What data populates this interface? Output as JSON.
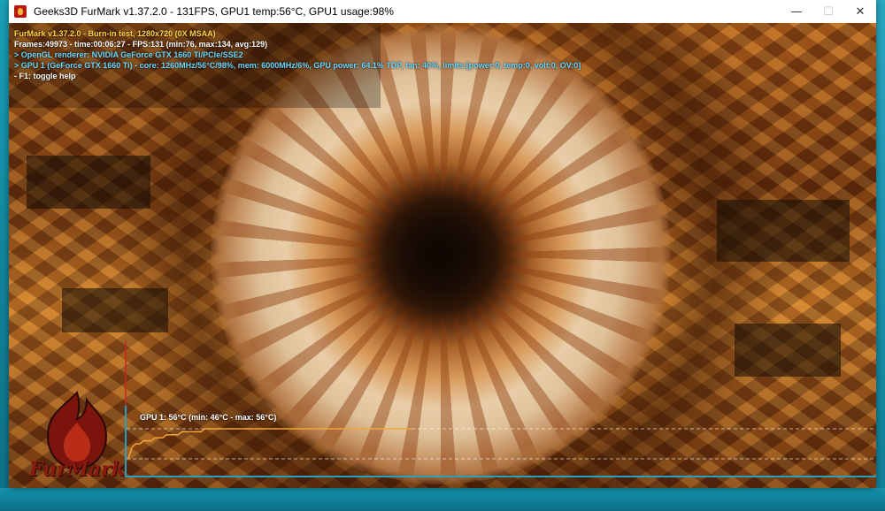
{
  "window": {
    "title": "Geeks3D FurMark v1.37.2.0 - 131FPS, GPU1 temp:56°C, GPU1 usage:98%",
    "controls": {
      "minimize": "—",
      "maximize": "☐",
      "close": "✕"
    }
  },
  "hud": {
    "line1": "FurMark v1.37.2.0 - Burn-in test, 1280x720 (0X MSAA)",
    "line2": "Frames:49973 - time:00:06:27 - FPS:131 (min:76, max:134, avg:129)",
    "line3": "> OpenGL renderer: NVIDIA GeForce GTX 1660 Ti/PCIe/SSE2",
    "line4": "> GPU 1 (GeForce GTX 1660 Ti) - core: 1260MHz/56°C/98%, mem: 6000MHz/6%, GPU power: 64.1% TDP, fan: 40%, limits:[power:0, temp:0, volt:0, OV:0]",
    "line5": "- F1: toggle help"
  },
  "graph": {
    "label": "GPU 1: 56°C (min: 46°C - max: 56°C)",
    "temp_min": 46,
    "temp_max": 56,
    "current": 56,
    "samples": [
      46,
      50,
      51,
      51,
      52,
      52,
      52,
      53,
      53,
      53,
      54,
      54,
      54,
      54,
      55,
      55,
      55,
      55,
      55,
      55,
      56,
      56,
      56,
      56,
      56,
      56,
      56,
      56,
      56,
      56,
      56,
      56,
      56,
      56,
      56,
      56,
      56,
      56,
      56,
      56,
      56,
      56,
      56,
      56,
      56,
      56,
      56,
      56,
      56,
      56,
      56,
      56,
      56,
      56,
      56,
      56,
      56,
      56,
      56,
      56,
      56,
      56,
      56,
      56,
      56,
      56,
      56,
      56,
      56,
      56,
      56,
      56,
      56,
      56,
      56
    ],
    "line_color": "#f2a53a",
    "axis_color": "#2aa0c0"
  },
  "logo": {
    "name": "FurMark"
  },
  "colors": {
    "hud_yellow": "#ffd54a",
    "hud_cyan": "#6ad8ff",
    "hud_white": "#ffffff"
  }
}
